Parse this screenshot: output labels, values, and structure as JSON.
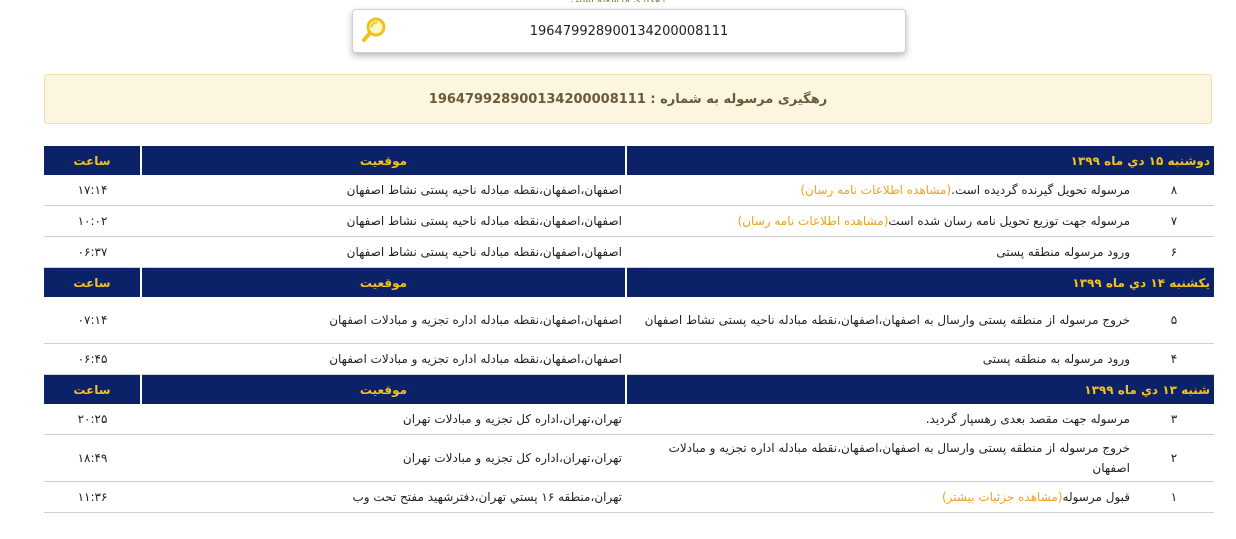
{
  "page": {
    "top_text": "رهگیری مرسوله پستی"
  },
  "search": {
    "value": "196479928900134200008111",
    "placeholder": ""
  },
  "banner": {
    "text": "رهگیری مرسوله به شماره : 196479928900134200008111"
  },
  "table": {
    "col_location": "موقعیت",
    "col_time": "ساعت",
    "groups": [
      {
        "date": "دوشنبه ۱۵ دي ماه ۱۳۹۹",
        "rows": [
          {
            "num": "۸",
            "desc": "مرسوله تحویل گیرنده گردیده است.",
            "link": "(مشاهده اطلاعات نامه رسان)",
            "location": "اصفهان،اصفهان،نقطه مبادله ناحیه پستی نشاط اصفهان",
            "time": "۱۷:۱۴"
          },
          {
            "num": "۷",
            "desc": "مرسوله جهت توزیع تحویل نامه رسان شده است",
            "link": "(مشاهده اطلاعات نامه رسان)",
            "location": "اصفهان،اصفهان،نقطه مبادله ناحیه پستی نشاط اصفهان",
            "time": "۱۰:۰۲"
          },
          {
            "num": "۶",
            "desc": "ورود مرسوله منطقه پستی",
            "link": "",
            "location": "اصفهان،اصفهان،نقطه مبادله ناحیه پستی نشاط اصفهان",
            "time": "۰۶:۳۷"
          }
        ]
      },
      {
        "date": "یکشنبه ۱۴ دي ماه ۱۳۹۹",
        "rows": [
          {
            "num": "۵",
            "desc": "خروج مرسوله از منطقه پستی وارسال به اصفهان،اصفهان،نقطه مبادله ناحیه پستی نشاط اصفهان",
            "link": "",
            "location": "اصفهان،اصفهان،نقطه مبادله اداره تجزیه و مبادلات اصفهان",
            "time": "۰۷:۱۴"
          },
          {
            "num": "۴",
            "desc": "ورود مرسوله به منطقه پستی",
            "link": "",
            "location": "اصفهان،اصفهان،نقطه مبادله اداره تجزیه و مبادلات اصفهان",
            "time": "۰۶:۴۵"
          }
        ]
      },
      {
        "date": "شنبه ۱۳ دي ماه ۱۳۹۹",
        "rows": [
          {
            "num": "۳",
            "desc": "مرسوله جهت مقصد بعدی رهسپار گردید.",
            "link": "",
            "location": "تهران،تهران،اداره کل تجزیه و مبادلات تهران",
            "time": "۲۰:۲۵"
          },
          {
            "num": "۲",
            "desc": "خروج مرسوله از منطقه پستی وارسال به اصفهان،اصفهان،نقطه مبادله اداره تجزیه و مبادلات اصفهان",
            "link": "",
            "location": "تهران،تهران،اداره کل تجزیه و مبادلات تهران",
            "time": "۱۸:۴۹"
          },
          {
            "num": "۱",
            "desc": "قبول مرسوله",
            "link": "(مشاهده جزئیات بیشتر)",
            "location": "تهران،منطقه ۱۶ پستي تهران،دفترشهید مفتح تحت وب",
            "time": "۱۱:۳۶"
          }
        ]
      }
    ]
  },
  "colors": {
    "header_bg": "#0b2168",
    "header_text": "#f3c21e",
    "link": "#f0a21e",
    "banner_bg": "#fcf6e1",
    "banner_text": "#6b5a37"
  },
  "icons": {
    "search": "magnifier-icon"
  }
}
